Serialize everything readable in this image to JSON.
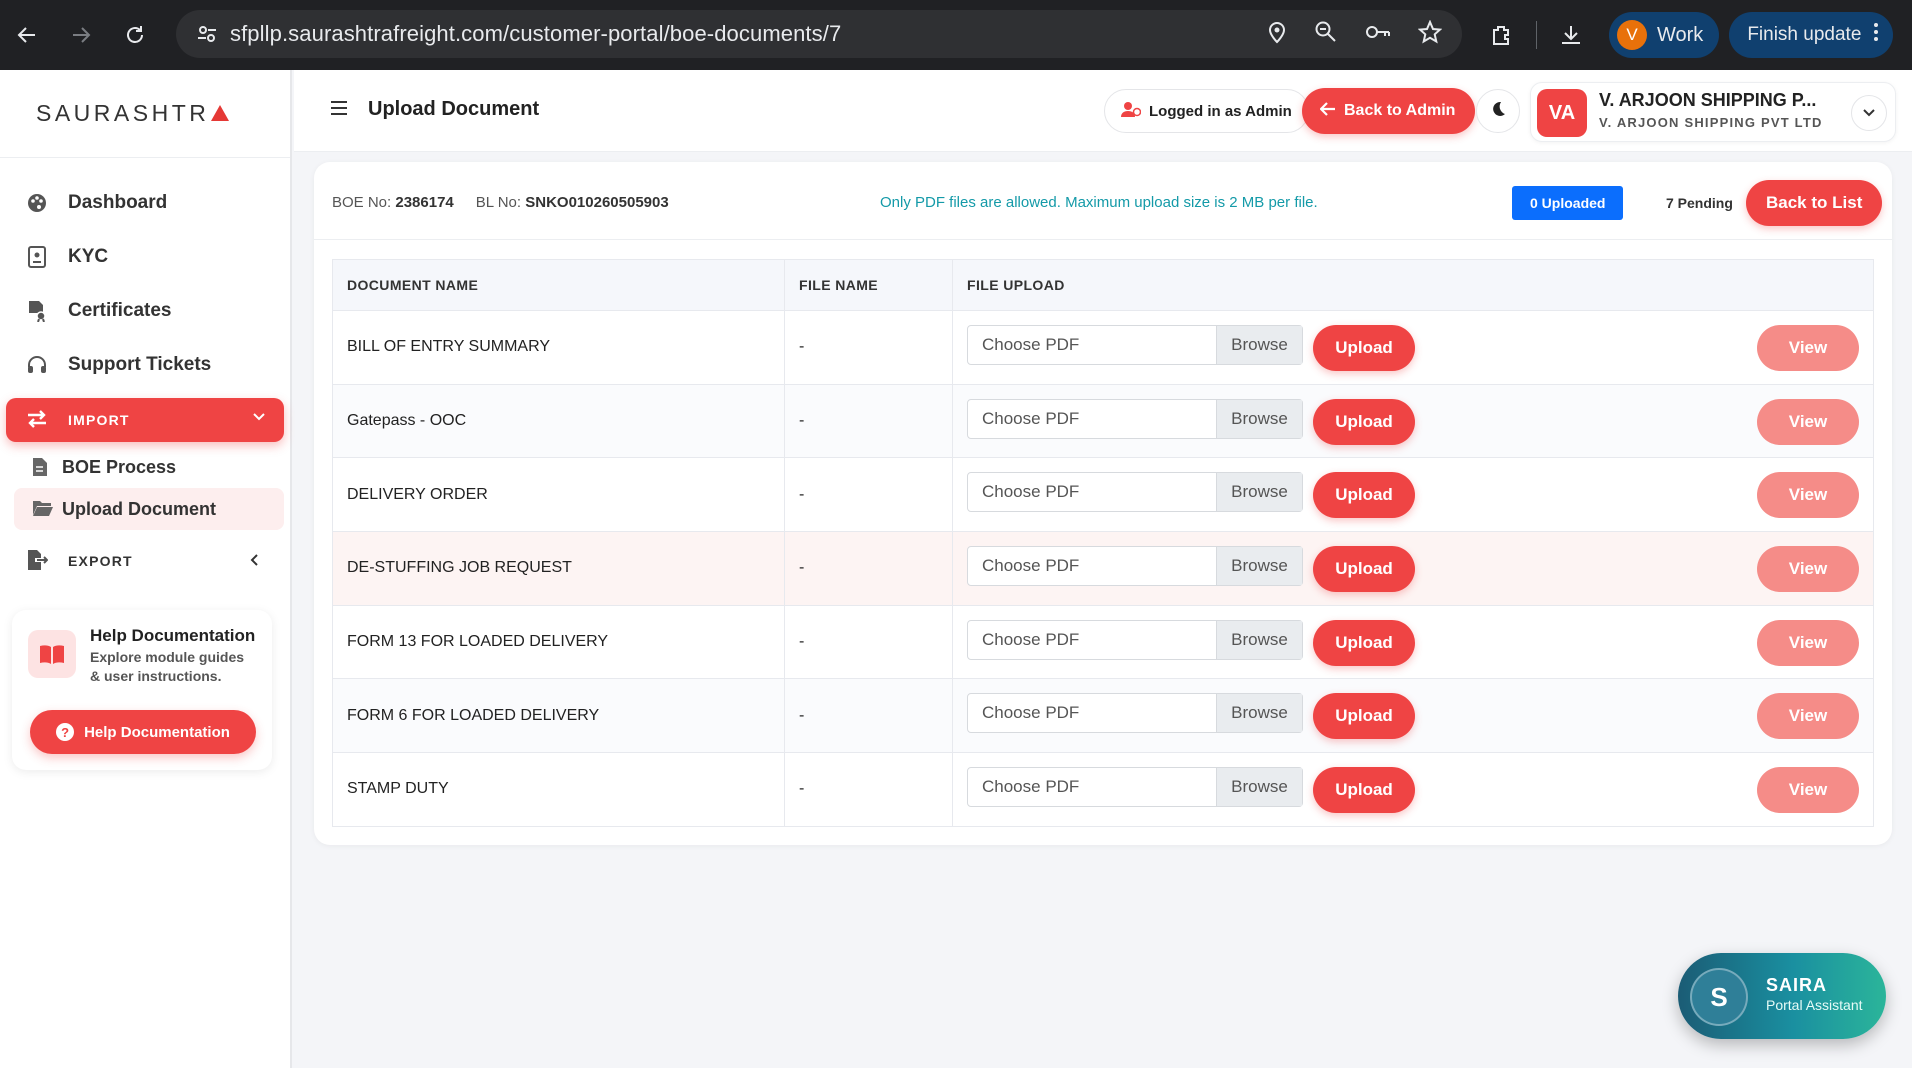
{
  "browser": {
    "url": "sfpllp.saurashtrafreight.com/customer-portal/boe-documents/7",
    "profile_initial": "V",
    "profile_label": "Work",
    "update_label": "Finish update"
  },
  "sidebar": {
    "logo": "SAURASHTR",
    "items": [
      {
        "label": "Dashboard",
        "icon": "palette-icon"
      },
      {
        "label": "KYC",
        "icon": "id-card-icon"
      },
      {
        "label": "Certificates",
        "icon": "certificate-icon"
      },
      {
        "label": "Support Tickets",
        "icon": "headset-icon"
      }
    ],
    "import_label": "IMPORT",
    "import_sub": [
      {
        "label": "BOE Process"
      },
      {
        "label": "Upload Document"
      }
    ],
    "export_label": "EXPORT",
    "help": {
      "title": "Help Documentation",
      "desc": "Explore module guides & user instructions.",
      "button": "Help Documentation"
    }
  },
  "header": {
    "title": "Upload Document",
    "logged_in": "Logged in as Admin",
    "back_admin": "Back to Admin",
    "user_initials": "VA",
    "user_name": "V. ARJOON SHIPPING P...",
    "user_company": "V. ARJOON SHIPPING PVT LTD"
  },
  "card": {
    "boe_label": "BOE No:",
    "boe_value": "2386174",
    "bl_label": "BL No:",
    "bl_value": "SNKO010260505903",
    "notice": "Only PDF files are allowed. Maximum upload size is 2 MB per file.",
    "uploaded": "0 Uploaded",
    "pending": "7 Pending",
    "back_list": "Back to List"
  },
  "table": {
    "headers": [
      "DOCUMENT NAME",
      "FILE NAME",
      "FILE UPLOAD"
    ],
    "file_placeholder": "Choose PDF",
    "browse_label": "Browse",
    "upload_label": "Upload",
    "view_label": "View",
    "rows": [
      {
        "name": "BILL OF ENTRY SUMMARY",
        "file": "-"
      },
      {
        "name": "Gatepass - OOC",
        "file": "-"
      },
      {
        "name": "DELIVERY ORDER",
        "file": "-"
      },
      {
        "name": "DE-STUFFING JOB REQUEST",
        "file": "-"
      },
      {
        "name": "FORM 13 FOR LOADED DELIVERY",
        "file": "-"
      },
      {
        "name": "FORM 6 FOR LOADED DELIVERY",
        "file": "-"
      },
      {
        "name": "STAMP DUTY",
        "file": "-"
      }
    ]
  },
  "assistant": {
    "initial": "S",
    "name": "SAIRA",
    "subtitle": "Portal Assistant"
  },
  "colors": {
    "accent": "#ef4444",
    "accent_light": "#f58c88",
    "chrome": "#202124",
    "notice": "#149aa8",
    "uploaded_badge": "#0b6efd"
  }
}
